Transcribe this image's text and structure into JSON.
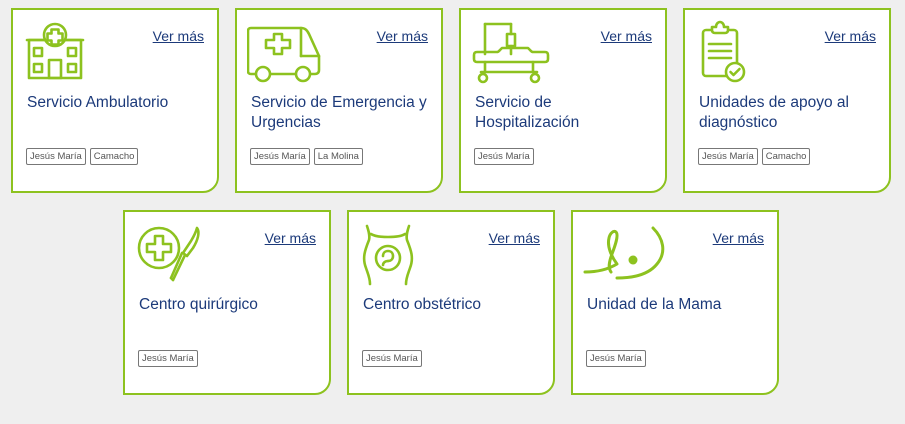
{
  "cards": [
    {
      "title": "Servicio Ambulatorio",
      "link": "Ver más",
      "icon": "clinic-building-icon",
      "tags": [
        "Jesús María",
        "Camacho"
      ]
    },
    {
      "title": "Servicio de Emergencia y Urgencias",
      "link": "Ver más",
      "icon": "ambulance-icon",
      "tags": [
        "Jesús María",
        "La Molina"
      ]
    },
    {
      "title": "Servicio de Hospitalización",
      "link": "Ver más",
      "icon": "hospital-bed-icon",
      "tags": [
        "Jesús María"
      ]
    },
    {
      "title": "Unidades de apoyo al diagnóstico",
      "link": "Ver más",
      "icon": "clipboard-check-icon",
      "tags": [
        "Jesús María",
        "Camacho"
      ]
    },
    {
      "title": "Centro quirúrgico",
      "link": "Ver más",
      "icon": "scalpel-cross-icon",
      "tags": [
        "Jesús María"
      ]
    },
    {
      "title": "Centro obstétrico",
      "link": "Ver más",
      "icon": "pregnancy-icon",
      "tags": [
        "Jesús María"
      ]
    },
    {
      "title": "Unidad de la Mama",
      "link": "Ver más",
      "icon": "breast-ribbon-icon",
      "tags": [
        "Jesús María"
      ]
    }
  ],
  "accent_color": "#8dc21f",
  "title_color": "#1c3a7a"
}
